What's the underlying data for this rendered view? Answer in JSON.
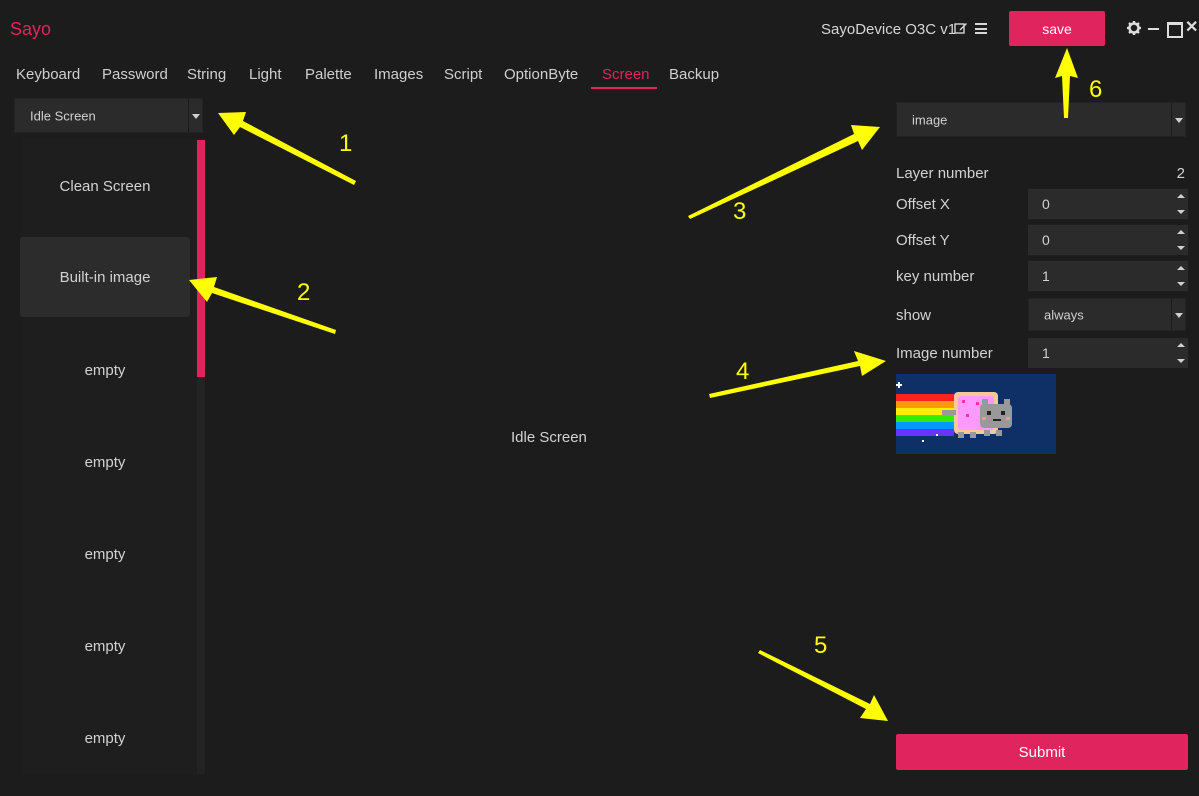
{
  "app": {
    "brand": "Sayo",
    "device_name": "SayoDevice O3C v1",
    "save_label": "save"
  },
  "tabs": [
    {
      "label": "Keyboard",
      "active": false
    },
    {
      "label": "Password",
      "active": false
    },
    {
      "label": "String",
      "active": false
    },
    {
      "label": "Light",
      "active": false
    },
    {
      "label": "Palette",
      "active": false
    },
    {
      "label": "Images",
      "active": false
    },
    {
      "label": "Script",
      "active": false
    },
    {
      "label": "OptionByte",
      "active": false
    },
    {
      "label": "Screen",
      "active": true
    },
    {
      "label": "Backup",
      "active": false
    }
  ],
  "screen_select": {
    "value": "Idle Screen"
  },
  "slots": [
    {
      "label": "Clean Screen",
      "selected": false
    },
    {
      "label": "Built-in image",
      "selected": true
    },
    {
      "label": "empty",
      "selected": false
    },
    {
      "label": "empty",
      "selected": false
    },
    {
      "label": "empty",
      "selected": false
    },
    {
      "label": "empty",
      "selected": false
    },
    {
      "label": "empty",
      "selected": false
    }
  ],
  "preview": {
    "label": "Idle Screen"
  },
  "properties": {
    "type_select": "image",
    "layer_number_label": "Layer number",
    "layer_number_value": "2",
    "offset_x_label": "Offset X",
    "offset_x_value": "0",
    "offset_y_label": "Offset Y",
    "offset_y_value": "0",
    "key_number_label": "key number",
    "key_number_value": "1",
    "show_label": "show",
    "show_value": "always",
    "image_number_label": "Image number",
    "image_number_value": "1"
  },
  "submit_label": "Submit",
  "annotations": [
    "1",
    "2",
    "3",
    "4",
    "5",
    "6"
  ],
  "colors": {
    "accent": "#e0245e",
    "annotation": "#ffff00",
    "background": "#1c1c1c"
  },
  "icons": [
    "edit-icon",
    "menu-icon",
    "gear-icon",
    "minimize-icon",
    "maximize-icon",
    "close-icon",
    "dropdown-caret-icon",
    "spinner-arrows-icon"
  ]
}
